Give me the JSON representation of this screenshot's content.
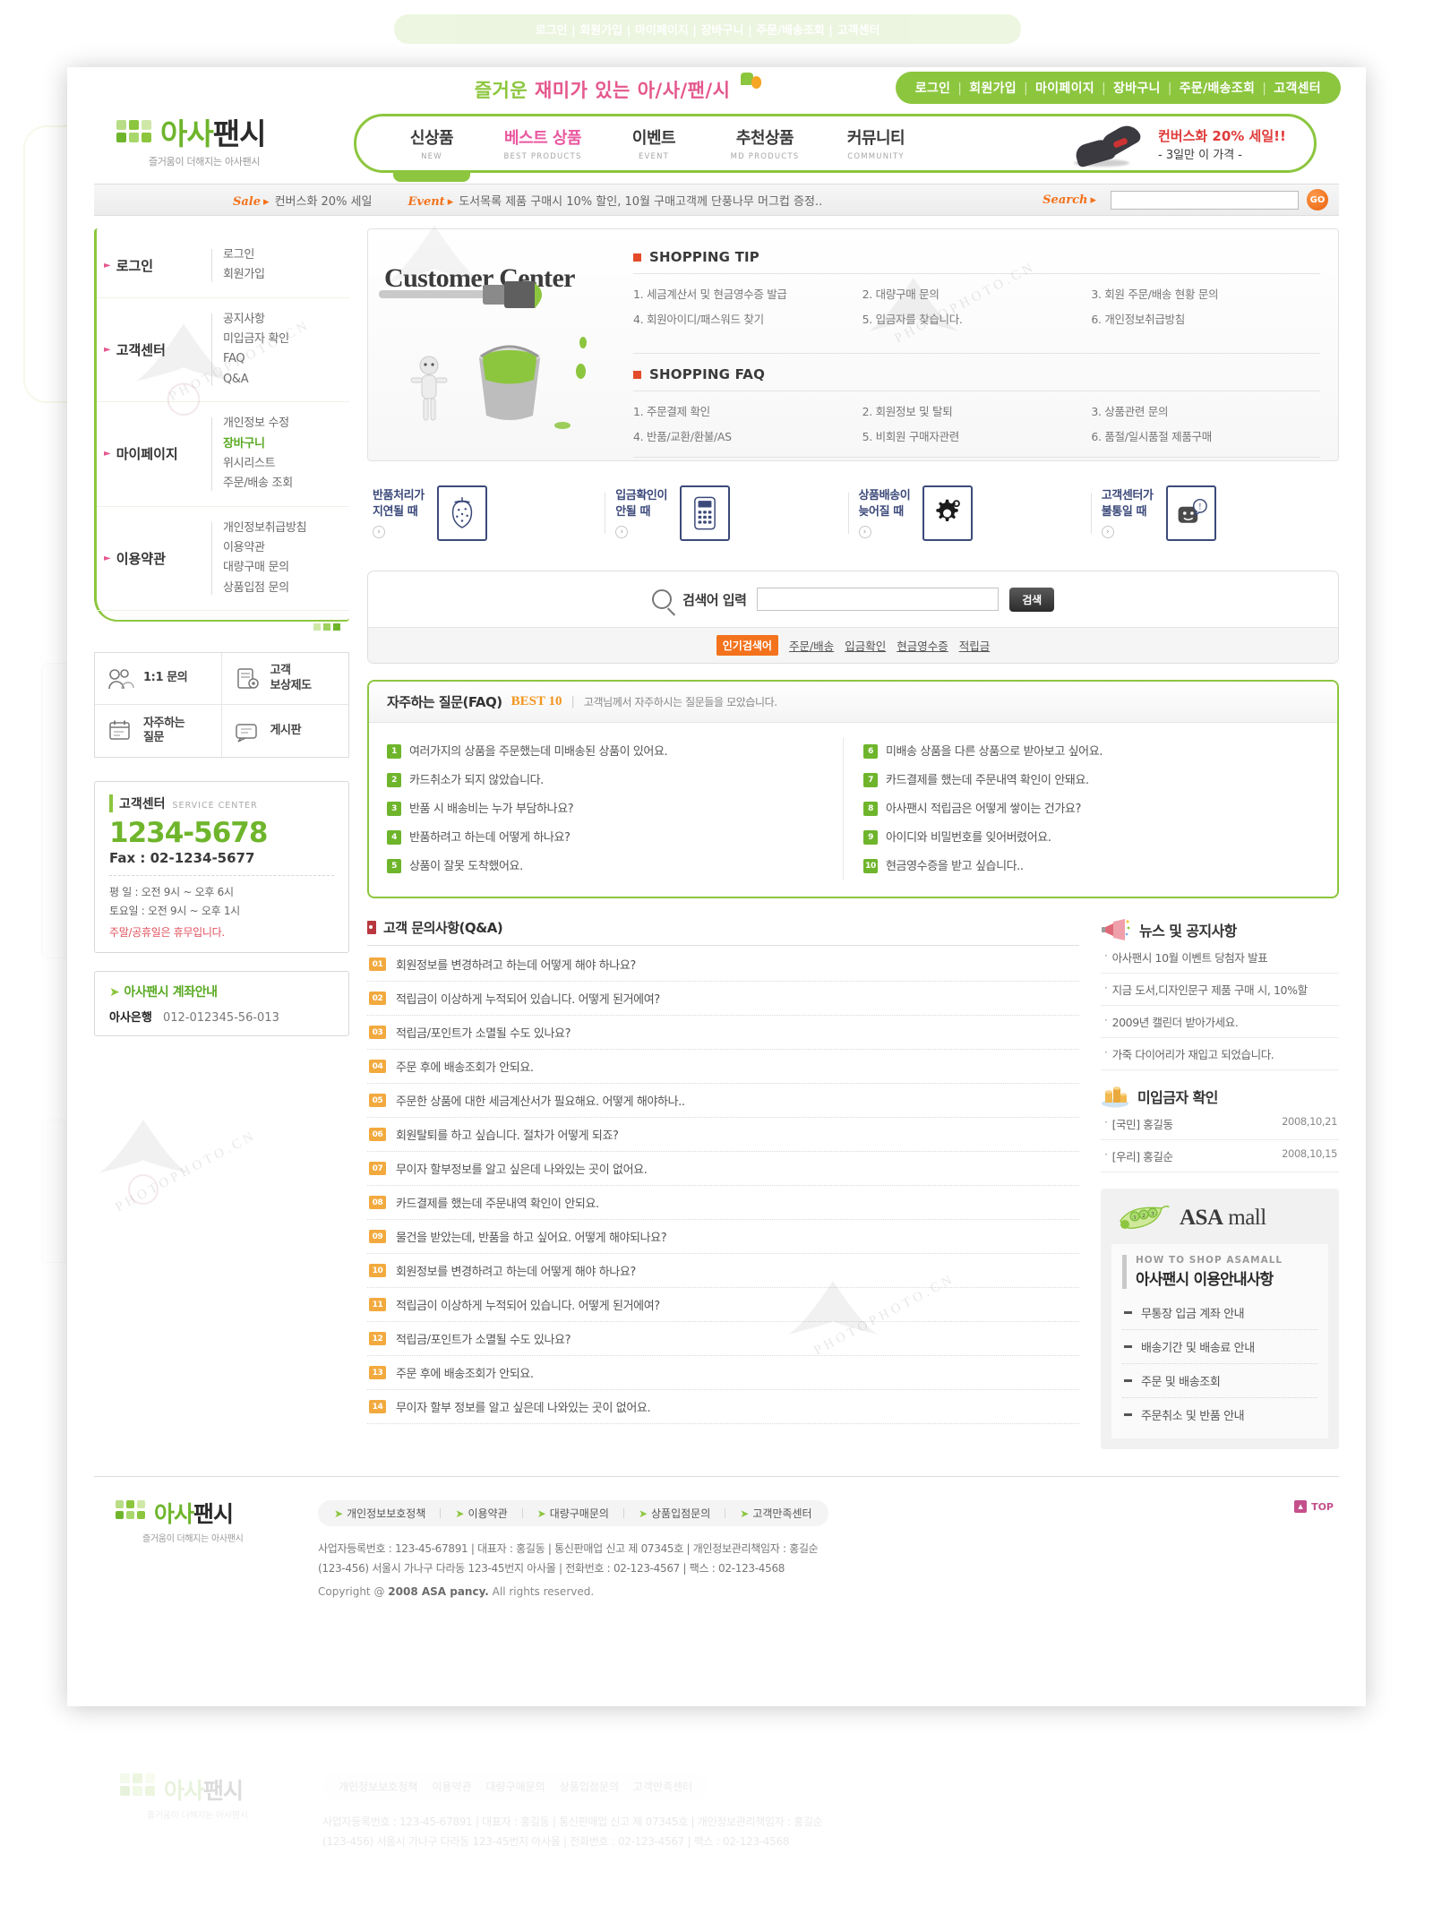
{
  "header": {
    "tagline_1": "즐거운",
    "tagline_2": "재미가 있는",
    "tagline_3": "아/사/팬/시",
    "toplinks": [
      "로그인",
      "회원가입",
      "마이페이지",
      "장바구니",
      "주문/배송조회",
      "고객센터"
    ],
    "logo_main_a": "아사",
    "logo_main_b": "팬시",
    "logo_sub": "즐거움이 더해지는 아사팬시",
    "nav": [
      {
        "ko": "신상품",
        "en": "NEW",
        "active": true
      },
      {
        "ko": "베스트 상품",
        "en": "BEST PRODUCTS",
        "active": false
      },
      {
        "ko": "이벤트",
        "en": "EVENT",
        "active": false
      },
      {
        "ko": "추천상품",
        "en": "MD PRODUCTS",
        "active": false
      },
      {
        "ko": "커뮤니티",
        "en": "COMMUNITY",
        "active": false
      }
    ],
    "promo_line1": "컨버스화 20% 세일!!",
    "promo_line2": "- 3일만 이 가격 -"
  },
  "strip": {
    "sale_label": "Sale",
    "sale_text": "컨버스화 20% 세일",
    "event_label": "Event",
    "event_text": "도서목록 제품 구매시 10% 할인, 10월 구매고객께 단풍나무 머그컵 증정..",
    "search_label": "Search",
    "search_value": "",
    "search_placeholder": "",
    "go_label": "GO"
  },
  "sidebar": {
    "groups": [
      {
        "head": "로그인",
        "links": [
          {
            "label": "로그인",
            "hot": false
          },
          {
            "label": "회원가입",
            "hot": false
          }
        ]
      },
      {
        "head": "고객센터",
        "links": [
          {
            "label": "공지사항",
            "hot": false
          },
          {
            "label": "미입금자 확인",
            "hot": false
          },
          {
            "label": "FAQ",
            "hot": false
          },
          {
            "label": "Q&A",
            "hot": false
          }
        ]
      },
      {
        "head": "마이페이지",
        "links": [
          {
            "label": "개인정보 수정",
            "hot": false
          },
          {
            "label": "장바구니",
            "hot": true
          },
          {
            "label": "위시리스트",
            "hot": false
          },
          {
            "label": "주문/배송 조회",
            "hot": false
          }
        ]
      },
      {
        "head": "이용약관",
        "links": [
          {
            "label": "개인정보취급방침",
            "hot": false
          },
          {
            "label": "이용약관",
            "hot": false
          },
          {
            "label": "대량구매 문의",
            "hot": false
          },
          {
            "label": "상품입점 문의",
            "hot": false
          }
        ]
      }
    ],
    "quad": [
      {
        "label": "1:1 문의",
        "icon": "people-icon"
      },
      {
        "label": "고객\n보상제도",
        "icon": "document-gear-icon"
      },
      {
        "label": "자주하는\n질문",
        "icon": "note-icon"
      },
      {
        "label": "게시판",
        "icon": "board-icon"
      }
    ],
    "service": {
      "title_ko": "고객센터",
      "title_en": "SERVICE CENTER",
      "tel": "1234-5678",
      "fax": "Fax : 02-1234-5677",
      "hours_weekday": "평  일 :  오전 9시 ~ 오후 6시",
      "hours_saturday": "토요일 :  오전 9시 ~ 오후 1시",
      "note": "주말/공휴일은 휴무입니다."
    },
    "bank": {
      "title": "아사팬시 계좌안내",
      "bank_name": "아사은행",
      "account": "012-012345-56-013"
    }
  },
  "customer_center": {
    "title": "Customer Center",
    "tip_heading": "SHOPPING TIP",
    "tips": [
      "1. 세금계산서 및 현금영수증 발급",
      "2. 대량구매 문의",
      "3. 회원 주문/배송 현황 문의",
      "4. 회원아이디/패스워드 찾기",
      "5. 입금자를 찾습니다.",
      "6. 개인정보취급방침"
    ],
    "faq_heading": "SHOPPING FAQ",
    "faqs": [
      "1. 주문결제 확인",
      "2. 회원정보 및 탈퇴",
      "3. 상품관련 문의",
      "4. 반품/교환/환불/AS",
      "5. 비회원 구매자관련",
      "6. 품절/일시품절 제품구매"
    ]
  },
  "icon_strip": [
    {
      "line1": "반품처리가",
      "line2": "지연될 때",
      "icon": "strawberry-icon"
    },
    {
      "line1": "입금확인이",
      "line2": "안될 때",
      "icon": "calculator-icon"
    },
    {
      "line1": "상품배송이",
      "line2": "늦어질 때",
      "icon": "gear-icon"
    },
    {
      "line1": "고객센터가",
      "line2": "불통일 때",
      "icon": "face-speech-icon"
    }
  ],
  "search_panel": {
    "label": "검색어 입력",
    "value": "",
    "placeholder": "",
    "button": "검색",
    "popular_label": "인기검색어",
    "keywords": [
      "주문/배송",
      "입금확인",
      "현금영수증",
      "적립금"
    ]
  },
  "faq_best": {
    "title_1": "자주하는 질문(FAQ)",
    "title_2": "BEST 10",
    "subtitle": "고객님께서 자주하시는 질문들을 모았습니다.",
    "left": [
      {
        "n": "1",
        "text": "여러가지의 상품을 주문했는데 미배송된 상품이 있어요."
      },
      {
        "n": "2",
        "text": "카드취소가 되지 않았습니다."
      },
      {
        "n": "3",
        "text": "반품 시 배송비는 누가 부담하나요?"
      },
      {
        "n": "4",
        "text": "반품하려고 하는데 어떻게 하나요?"
      },
      {
        "n": "5",
        "text": "상품이 잘못 도착했어요."
      }
    ],
    "right": [
      {
        "n": "6",
        "text": "미배송 상품을 다른 상품으로 받아보고 싶어요."
      },
      {
        "n": "7",
        "text": "카드결제를 했는데 주문내역 확인이 안돼요."
      },
      {
        "n": "8",
        "text": "아사팬시 적립금은 어떻게 쌓이는 건가요?"
      },
      {
        "n": "9",
        "text": "아이디와 비밀번호를 잊어버렸어요."
      },
      {
        "n": "10",
        "text": "현금영수증을 받고 싶습니다.."
      }
    ]
  },
  "qna": {
    "title": "고객 문의사항(Q&A)",
    "items": [
      {
        "n": "01",
        "text": "회원정보를 변경하려고 하는데 어떻게 해야 하나요?"
      },
      {
        "n": "02",
        "text": "적립금이 이상하게 누적되어 있습니다. 어떻게 된거에여?"
      },
      {
        "n": "03",
        "text": "적립금/포인트가 소멸될 수도 있나요?"
      },
      {
        "n": "04",
        "text": "주문 후에 배송조회가 안되요."
      },
      {
        "n": "05",
        "text": "주문한 상품에 대한 세금계산서가 필요해요. 어떻게 해야하나.."
      },
      {
        "n": "06",
        "text": "회원탈퇴를 하고 싶습니다. 절차가 어떻게 되죠?"
      },
      {
        "n": "07",
        "text": "무이자 할부정보를 알고 싶은데 나와있는 곳이 없어요."
      },
      {
        "n": "08",
        "text": "카드결제를 했는데 주문내역 확인이 안되요."
      },
      {
        "n": "09",
        "text": "물건을 받았는데, 반품을 하고 싶어요. 어떻게 해야되나요?"
      },
      {
        "n": "10",
        "text": "회원정보를 변경하려고 하는데 어떻게 해야 하나요?"
      },
      {
        "n": "11",
        "text": "적립금이 이상하게 누적되어 있습니다. 어떻게 된거에여?"
      },
      {
        "n": "12",
        "text": "적립금/포인트가 소멸될 수도 있나요?"
      },
      {
        "n": "13",
        "text": "주문 후에 배송조회가 안되요."
      },
      {
        "n": "14",
        "text": "무이자 할부 정보를 알고 싶은데 나와있는 곳이 없어요."
      }
    ]
  },
  "news": {
    "title": "뉴스 및 공지사항",
    "items": [
      "아사팬시 10월 이벤트 당첨자 발표",
      "지금 도서,디자인문구 제품 구매 시, 10%할",
      "2009년 캘린더 받아가세요.",
      "가죽 다이어리가 재입고 되었습니다."
    ]
  },
  "unpaid": {
    "title": "미입금자 확인",
    "rows": [
      {
        "name": "[국민] 홍길동",
        "date": "2008,10,21"
      },
      {
        "name": "[우리] 홍길순",
        "date": "2008,10,15"
      }
    ]
  },
  "asamall": {
    "logo_a": "ASA",
    "logo_b": "mall",
    "sub_en": "HOW TO SHOP ASAMALL",
    "sub_ko": "아사팬시 이용안내사항",
    "links": [
      "무통장 입금 계좌 안내",
      "배송기간 및 배송료 안내",
      "주문 및 배송조회",
      "주문취소 및 반품 안내"
    ]
  },
  "footer": {
    "policy": [
      "개인정보보호정책",
      "이용약관",
      "대량구매문의",
      "상품입점문의",
      "고객만족센터"
    ],
    "info_line1": "사업자등록번호 : 123-45-67891 | 대표자 : 홍길동 | 통신판매업 신고 제 07345호 | 개인정보관리책임자 : 홍길순",
    "info_line2": "(123-456) 서울시 가나구 다라동 123-45번지 아사몰 | 전화번호 : 02-123-4567 | 팩스 : 02-123-4568",
    "copyright_pre": "Copyright @ ",
    "copyright_b": "2008 ASA pancy.",
    "copyright_post": " All rights reserved.",
    "logo_main_a": "아사",
    "logo_main_b": "팬시",
    "logo_sub": "즐거움이 더해지는 아사팬시",
    "top_label": "TOP"
  },
  "watermark": {
    "text": "PHOTOPHOTO.CN",
    "brand": "PHOTOPHOTO"
  },
  "colors": {
    "green": "#8cc63e",
    "green_dark": "#6fb52c",
    "orange": "#f3721c",
    "pink": "#ea57a0",
    "navy": "#3c4a7a",
    "red": "#e34b2a"
  }
}
